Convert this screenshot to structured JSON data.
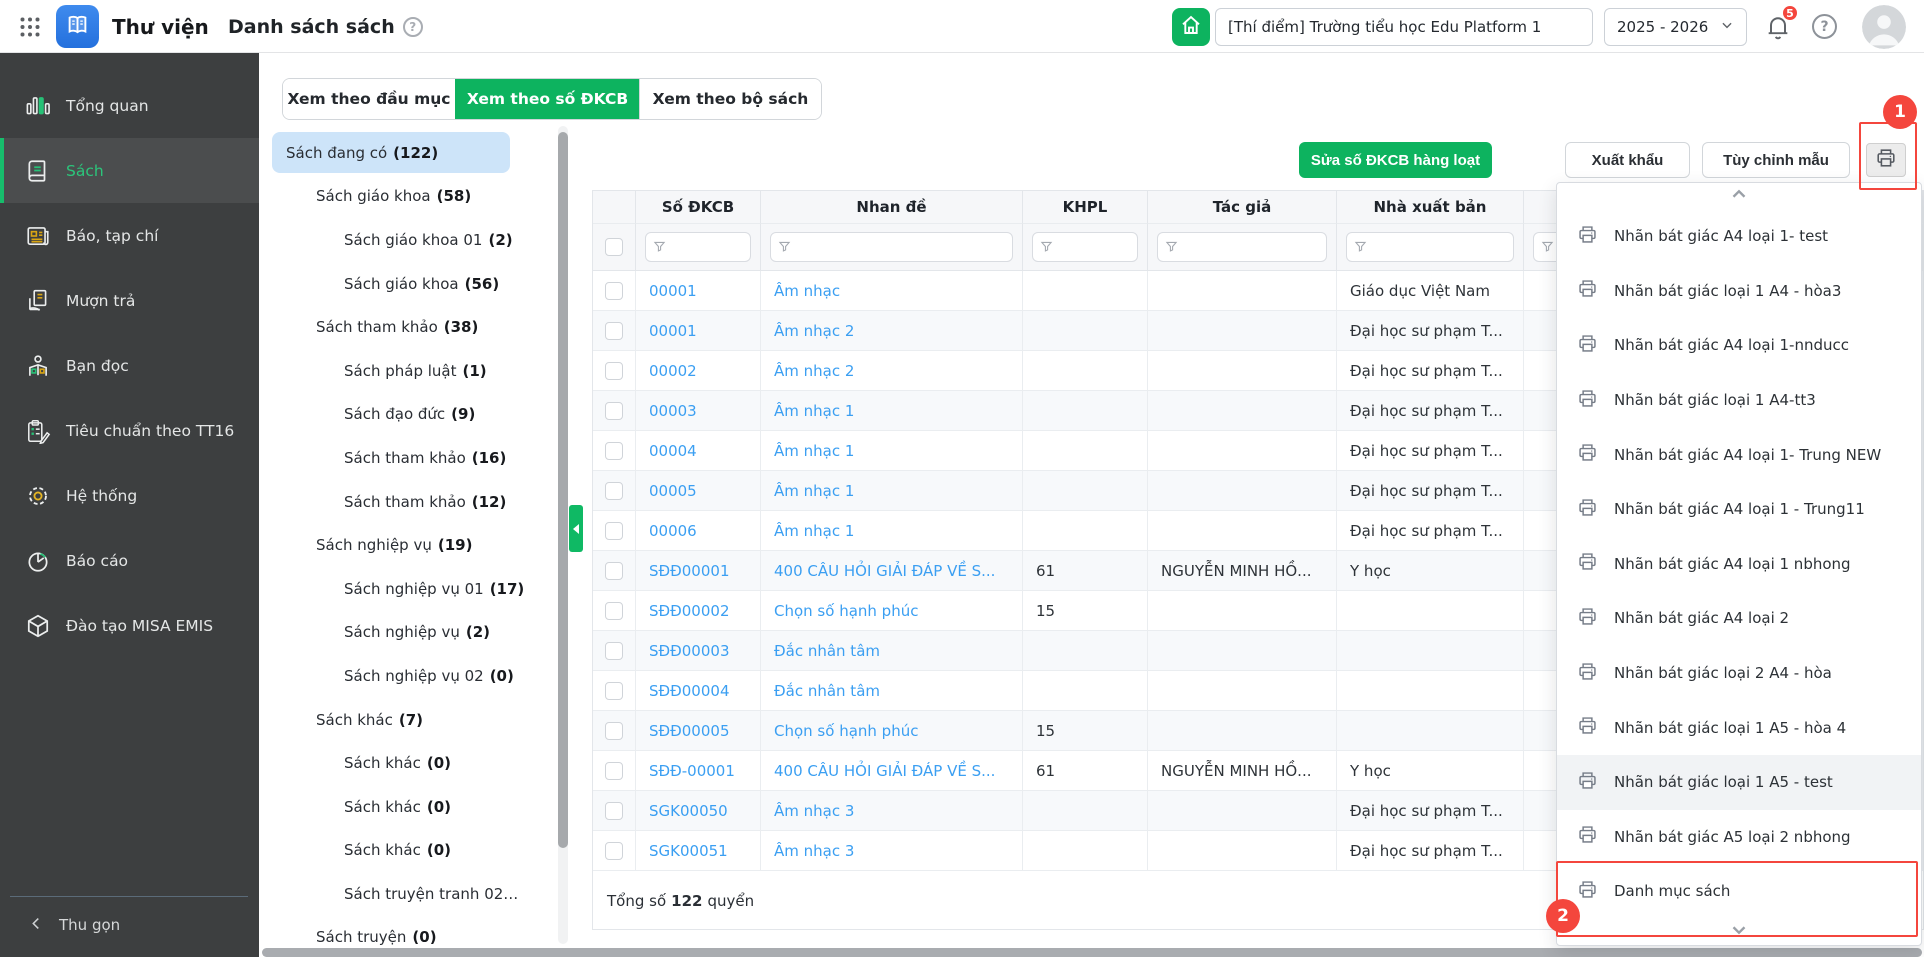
{
  "colors": {
    "accent_green": "#0db35f",
    "annotation_red": "#f4463d",
    "link_blue": "#3b9ff2",
    "tree_selected_bg": "#cde4f9"
  },
  "header": {
    "app_title": "Thư viện",
    "page_title": "Danh sách sách",
    "school_name": "[Thí điểm] Trường tiểu học Edu Platform 1",
    "school_year": "2025 - 2026",
    "notification_count": "5",
    "help_glyph": "?"
  },
  "sidebar": {
    "items": [
      {
        "label": "Tổng quan",
        "icon": "bar-chart-icon",
        "active": false
      },
      {
        "label": "Sách",
        "icon": "book-icon",
        "active": true
      },
      {
        "label": "Báo, tạp chí",
        "icon": "newspaper-icon",
        "active": false
      },
      {
        "label": "Mượn trả",
        "icon": "borrow-return-icon",
        "active": false
      },
      {
        "label": "Bạn đọc",
        "icon": "reader-icon",
        "active": false
      },
      {
        "label": "Tiêu chuẩn theo TT16",
        "icon": "clipboard-icon",
        "active": false
      },
      {
        "label": "Hệ thống",
        "icon": "gear-icon",
        "active": false
      },
      {
        "label": "Báo cáo",
        "icon": "report-icon",
        "active": false
      },
      {
        "label": "Đào tạo MISA EMIS",
        "icon": "cube-icon",
        "active": false
      }
    ],
    "collapse_label": "Thu gọn"
  },
  "tabs": {
    "items": [
      {
        "label": "Xem theo đầu mục",
        "active": false
      },
      {
        "label": "Xem theo số ĐKCB",
        "active": true
      },
      {
        "label": "Xem theo bộ sách",
        "active": false
      }
    ]
  },
  "tree": {
    "items": [
      {
        "label": "Sách đang có",
        "count": "(122)",
        "level": 0,
        "selected": true
      },
      {
        "label": "Sách giáo khoa",
        "count": "(58)",
        "level": 1
      },
      {
        "label": "Sách giáo khoa 01",
        "count": "(2)",
        "level": 2
      },
      {
        "label": "Sách giáo khoa",
        "count": "(56)",
        "level": 2
      },
      {
        "label": "Sách tham khảo",
        "count": "(38)",
        "level": 1
      },
      {
        "label": "Sách pháp luật",
        "count": "(1)",
        "level": 2
      },
      {
        "label": "Sách đạo đức",
        "count": "(9)",
        "level": 2
      },
      {
        "label": "Sách tham khảo",
        "count": "(16)",
        "level": 2
      },
      {
        "label": "Sách tham khảo",
        "count": "(12)",
        "level": 2
      },
      {
        "label": "Sách nghiệp vụ",
        "count": "(19)",
        "level": 1
      },
      {
        "label": "Sách nghiệp vụ 01",
        "count": "(17)",
        "level": 2
      },
      {
        "label": "Sách nghiệp vụ",
        "count": "(2)",
        "level": 2
      },
      {
        "label": "Sách nghiệp vụ 02",
        "count": "(0)",
        "level": 2
      },
      {
        "label": "Sách khác",
        "count": "(7)",
        "level": 1
      },
      {
        "label": "Sách khác",
        "count": "(0)",
        "level": 2
      },
      {
        "label": "Sách khác",
        "count": "(0)",
        "level": 2
      },
      {
        "label": "Sách khác",
        "count": "(0)",
        "level": 2
      },
      {
        "label": "Sách truyện tranh 02…",
        "count": "",
        "level": 2
      },
      {
        "label": "Sách truyện",
        "count": "(0)",
        "level": 1
      }
    ]
  },
  "toolbar": {
    "bulk_edit_label": "Sửa số ĐKCB hàng loạt",
    "export_label": "Xuất khẩu",
    "customize_label": "Tùy chỉnh mẫu",
    "print_icon": "printer-icon"
  },
  "table": {
    "columns": [
      "Số ĐKCB",
      "Nhan đề",
      "KHPL",
      "Tác giả",
      "Nhà xuất bản"
    ],
    "rows": [
      {
        "dkcb": "00001",
        "title": "Âm nhạc",
        "khpl": "",
        "author": "",
        "publisher": "Giáo dục Việt Nam"
      },
      {
        "dkcb": "00001",
        "title": "Âm nhạc 2",
        "khpl": "",
        "author": "",
        "publisher": "Đại học sư phạm T..."
      },
      {
        "dkcb": "00002",
        "title": "Âm nhạc 2",
        "khpl": "",
        "author": "",
        "publisher": "Đại học sư phạm T..."
      },
      {
        "dkcb": "00003",
        "title": "Âm nhạc 1",
        "khpl": "",
        "author": "",
        "publisher": "Đại học sư phạm T..."
      },
      {
        "dkcb": "00004",
        "title": "Âm nhạc 1",
        "khpl": "",
        "author": "",
        "publisher": "Đại học sư phạm T..."
      },
      {
        "dkcb": "00005",
        "title": "Âm nhạc 1",
        "khpl": "",
        "author": "",
        "publisher": "Đại học sư phạm T..."
      },
      {
        "dkcb": "00006",
        "title": "Âm nhạc 1",
        "khpl": "",
        "author": "",
        "publisher": "Đại học sư phạm T..."
      },
      {
        "dkcb": "SĐĐ00001",
        "title": "400 CÂU HỎI GIẢI ĐÁP VỀ S...",
        "khpl": "61",
        "author": "NGUYỄN MINH HỒ...",
        "publisher": "Y học"
      },
      {
        "dkcb": "SĐĐ00002",
        "title": "Chọn số hạnh phúc",
        "khpl": "15",
        "author": "",
        "publisher": ""
      },
      {
        "dkcb": "SĐĐ00003",
        "title": "Đắc nhân tâm",
        "khpl": "",
        "author": "",
        "publisher": ""
      },
      {
        "dkcb": "SĐĐ00004",
        "title": "Đắc nhân tâm",
        "khpl": "",
        "author": "",
        "publisher": ""
      },
      {
        "dkcb": "SĐĐ00005",
        "title": "Chọn số hạnh phúc",
        "khpl": "15",
        "author": "",
        "publisher": ""
      },
      {
        "dkcb": "SĐĐ-00001",
        "title": "400 CÂU HỎI GIẢI ĐÁP VỀ S...",
        "khpl": "61",
        "author": "NGUYỄN MINH HỒ...",
        "publisher": "Y học"
      },
      {
        "dkcb": "SGK00050",
        "title": "Âm nhạc 3",
        "khpl": "",
        "author": "",
        "publisher": "Đại học sư phạm T..."
      },
      {
        "dkcb": "SGK00051",
        "title": "Âm nhạc 3",
        "khpl": "",
        "author": "",
        "publisher": "Đại học sư phạm T..."
      }
    ],
    "footer": {
      "total_prefix": "Tổng số",
      "total_value": "122",
      "total_suffix": "quyển"
    }
  },
  "print_menu": {
    "icon": "printer-icon",
    "items": [
      {
        "label": "Nhãn bát giác A4 loại 1- test"
      },
      {
        "label": "Nhãn bát giác loại 1 A4 - hòa3"
      },
      {
        "label": "Nhãn bát giác A4 loại 1-nnducc"
      },
      {
        "label": "Nhãn bát giác loại 1 A4-tt3"
      },
      {
        "label": "Nhãn bát giác A4 loại 1- Trung NEW"
      },
      {
        "label": "Nhãn bát giác A4 loại 1 - Trung11"
      },
      {
        "label": "Nhãn bát giác A4 loại 1 nbhong"
      },
      {
        "label": "Nhãn bát giác A4 loại 2"
      },
      {
        "label": "Nhãn bát giác loại 2 A4 - hòa"
      },
      {
        "label": "Nhãn bát giác loại 1 A5 - hòa 4"
      },
      {
        "label": "Nhãn bát giác loại 1 A5 - test",
        "highlighted": true
      },
      {
        "label": "Nhãn bát giác A5 loại 2 nbhong"
      },
      {
        "label": "Danh mục sách",
        "annotated": true
      }
    ]
  },
  "annotations": {
    "step1": "1",
    "step2": "2"
  }
}
